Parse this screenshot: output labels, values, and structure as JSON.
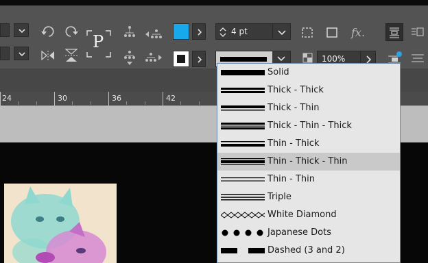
{
  "control_bar": {
    "stroke_weight": "4 pt",
    "opacity": "100%",
    "fill_color": "#17a9ec",
    "type_glyph": "P",
    "fx_label": "fx."
  },
  "ruler": {
    "labels": [
      "24",
      "30",
      "36",
      "42"
    ]
  },
  "stroke_type_menu": {
    "selected_index": 5,
    "items": [
      {
        "label": "Solid",
        "sample": "solid"
      },
      {
        "label": "Thick - Thick",
        "sample": "thick-thick"
      },
      {
        "label": "Thick - Thin",
        "sample": "thick-thin"
      },
      {
        "label": "Thick - Thin - Thick",
        "sample": "thick-thin-thick"
      },
      {
        "label": "Thin - Thick",
        "sample": "thin-thick"
      },
      {
        "label": "Thin - Thick - Thin",
        "sample": "thin-thick-thin"
      },
      {
        "label": "Thin - Thin",
        "sample": "thin-thin"
      },
      {
        "label": "Triple",
        "sample": "triple"
      },
      {
        "label": "White Diamond",
        "sample": "white-diamond"
      },
      {
        "label": "Japanese Dots",
        "sample": "japanese-dots"
      },
      {
        "label": "Dashed (3 and 2)",
        "sample": "dashed-3-2"
      }
    ]
  },
  "colors": {
    "panel": "#535353",
    "pasteboard": "#bdbdbd",
    "menu_bg": "#e6e6e6",
    "menu_selected": "#c9c9c9"
  }
}
